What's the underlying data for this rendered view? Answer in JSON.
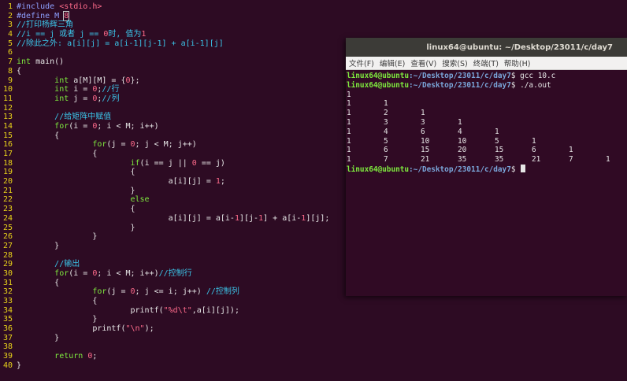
{
  "editor": {
    "lines": [
      {
        "n": "1",
        "segs": [
          [
            "pp",
            "#include "
          ],
          [
            "str",
            "<stdio.h>"
          ]
        ]
      },
      {
        "n": "2",
        "segs": [
          [
            "pp",
            "#define M "
          ],
          [
            "num-cursor",
            "8"
          ]
        ]
      },
      {
        "n": "3",
        "segs": [
          [
            "cm",
            "//打印杨辉三角"
          ]
        ]
      },
      {
        "n": "4",
        "segs": [
          [
            "cm",
            "//i == j 或者 j == "
          ],
          [
            "num",
            "0"
          ],
          [
            "cm",
            "时, 值为"
          ],
          [
            "num",
            "1"
          ]
        ]
      },
      {
        "n": "5",
        "segs": [
          [
            "cm",
            "//除此之外: a[i][j] = a[i-1][j-1] + a[i-1][j]"
          ]
        ]
      },
      {
        "n": "6",
        "segs": []
      },
      {
        "n": "7",
        "segs": [
          [
            "kw",
            "int"
          ],
          [
            "code",
            " main()"
          ]
        ]
      },
      {
        "n": "8",
        "segs": [
          [
            "code",
            "{"
          ]
        ]
      },
      {
        "n": "9",
        "segs": [
          [
            "code",
            "        "
          ],
          [
            "kw",
            "int"
          ],
          [
            "code",
            " a[M][M] = {"
          ],
          [
            "num",
            "0"
          ],
          [
            "code",
            "};"
          ]
        ]
      },
      {
        "n": "10",
        "segs": [
          [
            "code",
            "        "
          ],
          [
            "kw",
            "int"
          ],
          [
            "code",
            " i = "
          ],
          [
            "num",
            "0"
          ],
          [
            "code",
            ";"
          ],
          [
            "cm",
            "//行"
          ]
        ]
      },
      {
        "n": "11",
        "segs": [
          [
            "code",
            "        "
          ],
          [
            "kw",
            "int"
          ],
          [
            "code",
            " j = "
          ],
          [
            "num",
            "0"
          ],
          [
            "code",
            ";"
          ],
          [
            "cm",
            "//列"
          ]
        ]
      },
      {
        "n": "12",
        "segs": []
      },
      {
        "n": "13",
        "segs": [
          [
            "code",
            "        "
          ],
          [
            "cm",
            "//给矩阵中赋值"
          ]
        ]
      },
      {
        "n": "14",
        "segs": [
          [
            "code",
            "        "
          ],
          [
            "kw",
            "for"
          ],
          [
            "code",
            "(i = "
          ],
          [
            "num",
            "0"
          ],
          [
            "code",
            "; i < M; i++)"
          ]
        ]
      },
      {
        "n": "15",
        "segs": [
          [
            "code",
            "        {"
          ]
        ]
      },
      {
        "n": "16",
        "segs": [
          [
            "code",
            "                "
          ],
          [
            "kw",
            "for"
          ],
          [
            "code",
            "(j = "
          ],
          [
            "num",
            "0"
          ],
          [
            "code",
            "; j < M; j++)"
          ]
        ]
      },
      {
        "n": "17",
        "segs": [
          [
            "code",
            "                {"
          ]
        ]
      },
      {
        "n": "18",
        "segs": [
          [
            "code",
            "                        "
          ],
          [
            "kw",
            "if"
          ],
          [
            "code",
            "(i == j || "
          ],
          [
            "num",
            "0"
          ],
          [
            "code",
            " == j)"
          ]
        ]
      },
      {
        "n": "19",
        "segs": [
          [
            "code",
            "                        {"
          ]
        ]
      },
      {
        "n": "20",
        "segs": [
          [
            "code",
            "                                a[i][j] = "
          ],
          [
            "num",
            "1"
          ],
          [
            "code",
            ";"
          ]
        ]
      },
      {
        "n": "21",
        "segs": [
          [
            "code",
            "                        }"
          ]
        ]
      },
      {
        "n": "22",
        "segs": [
          [
            "code",
            "                        "
          ],
          [
            "kw",
            "else"
          ]
        ]
      },
      {
        "n": "23",
        "segs": [
          [
            "code",
            "                        {"
          ]
        ]
      },
      {
        "n": "24",
        "segs": [
          [
            "code",
            "                                a[i][j] = a[i-"
          ],
          [
            "num",
            "1"
          ],
          [
            "code",
            "][j-"
          ],
          [
            "num",
            "1"
          ],
          [
            "code",
            "] + a[i-"
          ],
          [
            "num",
            "1"
          ],
          [
            "code",
            "][j];"
          ]
        ]
      },
      {
        "n": "25",
        "segs": [
          [
            "code",
            "                        }"
          ]
        ]
      },
      {
        "n": "26",
        "segs": [
          [
            "code",
            "                }"
          ]
        ]
      },
      {
        "n": "27",
        "segs": [
          [
            "code",
            "        }"
          ]
        ]
      },
      {
        "n": "28",
        "segs": []
      },
      {
        "n": "29",
        "segs": [
          [
            "code",
            "        "
          ],
          [
            "cm",
            "//输出"
          ]
        ]
      },
      {
        "n": "30",
        "segs": [
          [
            "code",
            "        "
          ],
          [
            "kw",
            "for"
          ],
          [
            "code",
            "(i = "
          ],
          [
            "num",
            "0"
          ],
          [
            "code",
            "; i < M; i++)"
          ],
          [
            "cm",
            "//控制行"
          ]
        ]
      },
      {
        "n": "31",
        "segs": [
          [
            "code",
            "        {"
          ]
        ]
      },
      {
        "n": "32",
        "segs": [
          [
            "code",
            "                "
          ],
          [
            "kw",
            "for"
          ],
          [
            "code",
            "(j = "
          ],
          [
            "num",
            "0"
          ],
          [
            "code",
            "; j <= i; j++) "
          ],
          [
            "cm",
            "//控制列"
          ]
        ]
      },
      {
        "n": "33",
        "segs": [
          [
            "code",
            "                {"
          ]
        ]
      },
      {
        "n": "34",
        "segs": [
          [
            "code",
            "                        printf("
          ],
          [
            "str",
            "\"%d\\t\""
          ],
          [
            "code",
            ",a[i][j]);"
          ]
        ]
      },
      {
        "n": "35",
        "segs": [
          [
            "code",
            "                }"
          ]
        ]
      },
      {
        "n": "36",
        "segs": [
          [
            "code",
            "                printf("
          ],
          [
            "str",
            "\"\\n\""
          ],
          [
            "code",
            ");"
          ]
        ]
      },
      {
        "n": "37",
        "segs": [
          [
            "code",
            "        }"
          ]
        ]
      },
      {
        "n": "38",
        "segs": []
      },
      {
        "n": "39",
        "segs": [
          [
            "code",
            "        "
          ],
          [
            "kw",
            "return"
          ],
          [
            "code",
            " "
          ],
          [
            "num",
            "0"
          ],
          [
            "code",
            ";"
          ]
        ]
      },
      {
        "n": "40",
        "segs": [
          [
            "code",
            "}"
          ]
        ]
      }
    ]
  },
  "terminal": {
    "title": "linux64@ubuntu: ~/Desktop/23011/c/day7",
    "menu": [
      "文件(F)",
      "编辑(E)",
      "查看(V)",
      "搜索(S)",
      "终端(T)",
      "帮助(H)"
    ],
    "prompt_user": "linux64@ubuntu",
    "prompt_path": ":~/Desktop/23011/c/day7",
    "prompt_sign": "$ ",
    "commands": [
      "gcc 10.c",
      "./a.out"
    ],
    "output_rows": [
      [
        "1"
      ],
      [
        "1",
        "1"
      ],
      [
        "1",
        "2",
        "1"
      ],
      [
        "1",
        "3",
        "3",
        "1"
      ],
      [
        "1",
        "4",
        "6",
        "4",
        "1"
      ],
      [
        "1",
        "5",
        "10",
        "10",
        "5",
        "1"
      ],
      [
        "1",
        "6",
        "15",
        "20",
        "15",
        "6",
        "1"
      ],
      [
        "1",
        "7",
        "21",
        "35",
        "35",
        "21",
        "7",
        "1"
      ]
    ]
  }
}
